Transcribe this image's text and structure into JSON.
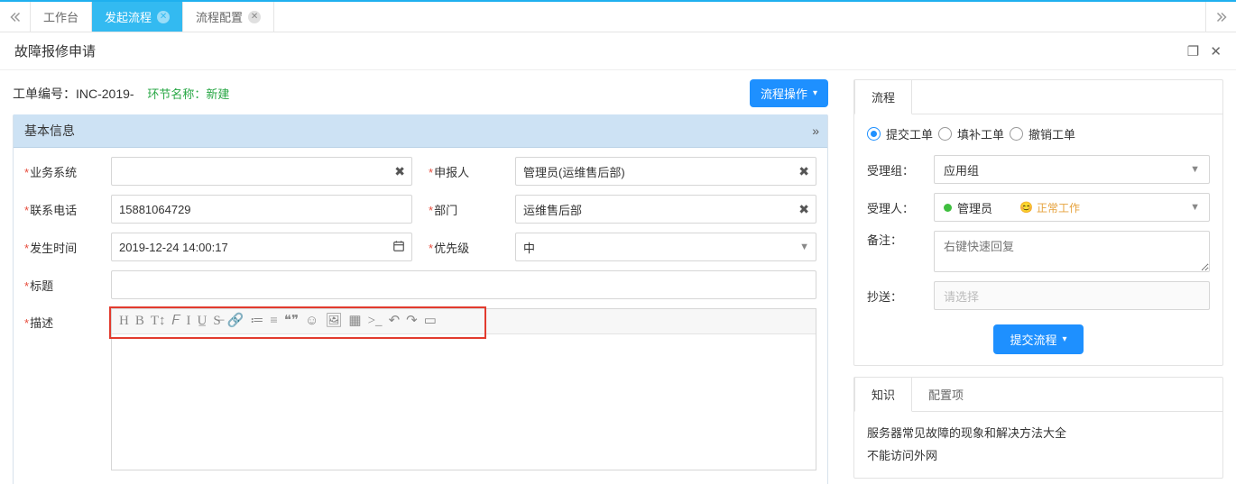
{
  "tabs": {
    "t0": "工作台",
    "t1": "发起流程",
    "t2": "流程配置"
  },
  "page": {
    "title": "故障报修申请",
    "order_label": "工单编号：",
    "order_id": "INC-2019-",
    "stage_key": "环节名称：",
    "stage_val": "新建",
    "action_btn": "流程操作"
  },
  "panel": {
    "basic_title": "基本信息"
  },
  "labels": {
    "system": "业务系统",
    "reporter": "申报人",
    "phone": "联系电话",
    "dept": "部门",
    "time": "发生时间",
    "priority": "优先级",
    "title": "标题",
    "desc": "描述"
  },
  "values": {
    "system": "",
    "reporter": "管理员(运维售后部)",
    "phone": "15881064729",
    "dept": "运维售后部",
    "time": "2019-12-24 14:00:17",
    "priority": "中",
    "title": ""
  },
  "toolbar_icons": [
    "H",
    "B",
    "T↕",
    "𝐹",
    "I",
    "U̲",
    "S̶",
    "🔗",
    "≔",
    "≡",
    "❝❞",
    "☺",
    "🖼",
    "▦",
    ">_",
    "↶",
    "↷",
    "▭"
  ],
  "side": {
    "tab_flow": "流程",
    "radio_submit": "提交工单",
    "radio_fill": "填补工单",
    "radio_cancel": "撤销工单",
    "group_label": "受理组：",
    "group_value": "应用组",
    "person_label": "受理人：",
    "person_value": "管理员",
    "person_status": "正常工作",
    "remark_label": "备注：",
    "remark_placeholder": "右键快速回复",
    "cc_label": "抄送：",
    "cc_placeholder": "请选择",
    "submit_btn": "提交流程"
  },
  "kb": {
    "tab_knowledge": "知识",
    "tab_config": "配置项",
    "items": {
      "i0": "服务器常见故障的现象和解决方法大全",
      "i1": "不能访问外网"
    }
  }
}
